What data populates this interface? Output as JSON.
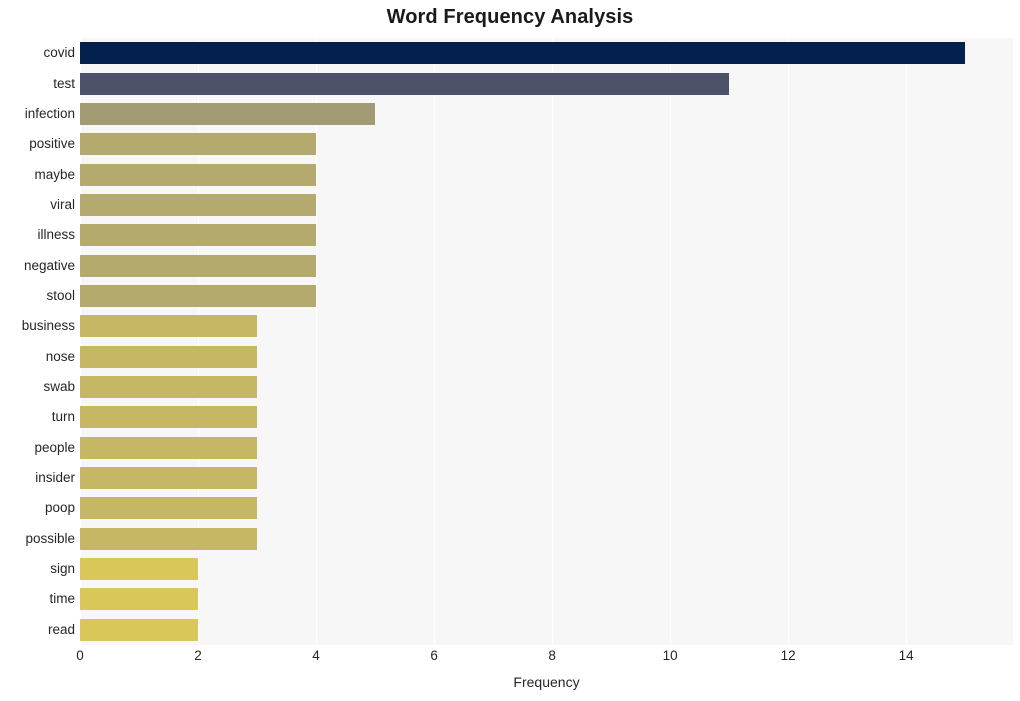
{
  "chart_data": {
    "type": "bar",
    "orientation": "horizontal",
    "title": "Word Frequency Analysis",
    "xlabel": "Frequency",
    "ylabel": "",
    "categories": [
      "covid",
      "test",
      "infection",
      "positive",
      "maybe",
      "viral",
      "illness",
      "negative",
      "stool",
      "business",
      "nose",
      "swab",
      "turn",
      "people",
      "insider",
      "poop",
      "possible",
      "sign",
      "time",
      "read"
    ],
    "values": [
      15,
      11,
      5,
      4,
      4,
      4,
      4,
      4,
      4,
      3,
      3,
      3,
      3,
      3,
      3,
      3,
      3,
      2,
      2,
      2
    ],
    "bar_colors": [
      "#03214c",
      "#4b5269",
      "#a39b74",
      "#b5aa6d",
      "#b5aa6d",
      "#b5aa6d",
      "#b5aa6d",
      "#b5aa6d",
      "#b5aa6d",
      "#c6b765",
      "#c6b765",
      "#c6b765",
      "#c6b765",
      "#c6b765",
      "#c6b765",
      "#c6b765",
      "#c6b765",
      "#dac75a",
      "#dac75a",
      "#dac75a"
    ],
    "xlim": [
      0,
      15.81
    ],
    "xticks": [
      0,
      2,
      4,
      6,
      8,
      10,
      12,
      14
    ],
    "xtick_labels": [
      "0",
      "2",
      "4",
      "6",
      "8",
      "10",
      "12",
      "14"
    ],
    "grid": true,
    "grid_axis": "x",
    "grid_color": "#ffffff",
    "legend": "none",
    "plot_background": "#f7f7f7",
    "figure_background": "#ffffff"
  }
}
